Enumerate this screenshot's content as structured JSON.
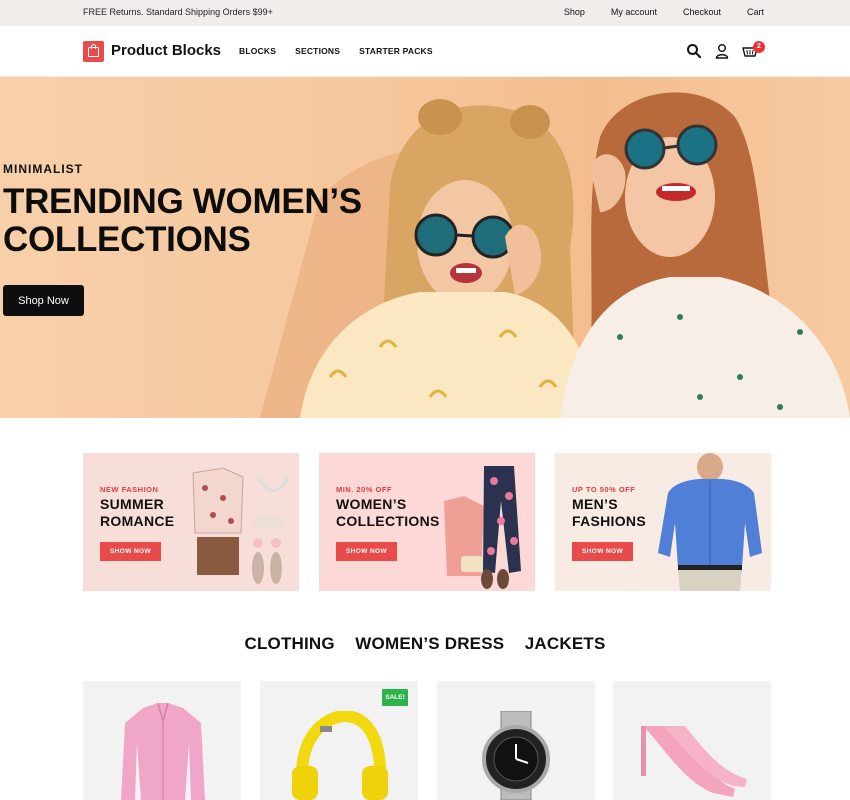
{
  "topbar": {
    "message": "FREE Returns. Standard Shipping Orders $99+",
    "links": [
      "Shop",
      "My account",
      "Checkout",
      "Cart"
    ]
  },
  "header": {
    "brand": "Product Blocks",
    "nav": [
      "BLOCKS",
      "SECTIONS",
      "STARTER PACKS"
    ],
    "cart_count": "2",
    "icons": [
      "search-icon",
      "user-icon",
      "cart-icon"
    ]
  },
  "hero": {
    "eyebrow": "MINIMALIST",
    "title": "TRENDING WOMEN’S COLLECTIONS",
    "cta": "Shop Now"
  },
  "banners": [
    {
      "kicker": "NEW FASHION",
      "title": "SUMMER ROMANCE",
      "button": "SHOW NOW",
      "bg": "#f7ded9"
    },
    {
      "kicker": "MIN. 20% OFF",
      "title": "WOMEN’S COLLECTIONS",
      "button": "SHOW NOW",
      "bg": "#fcd8d6"
    },
    {
      "kicker": "UP TO 50% OFF",
      "title": "MEN’S FASHIONS",
      "button": "SHOW NOW",
      "bg": "#f8ebe3"
    }
  ],
  "tabs": [
    "CLOTHING",
    "WOMEN’S DRESS",
    "JACKETS"
  ],
  "products": [
    {
      "icon": "pink-shirt"
    },
    {
      "icon": "yellow-headphones",
      "badge": "SALE!"
    },
    {
      "icon": "wristwatch"
    },
    {
      "icon": "pink-high-heels"
    }
  ],
  "colors": {
    "accent": "#e94b4b",
    "sale": "#2db34a",
    "dark": "#0d0d0d"
  }
}
